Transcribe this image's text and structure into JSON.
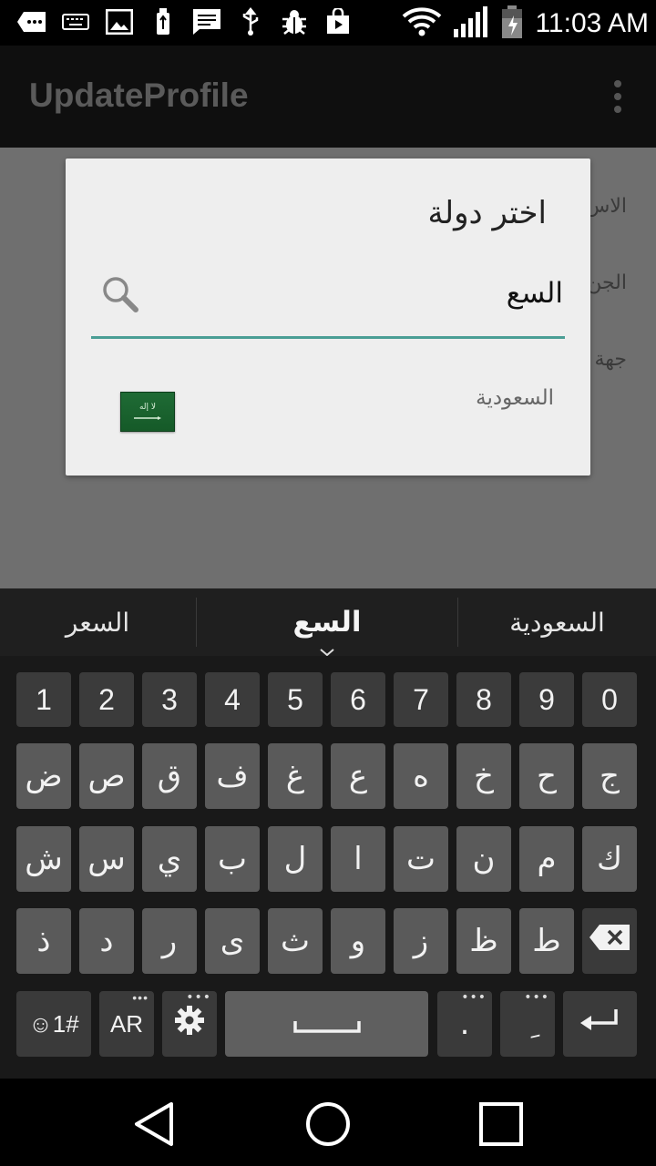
{
  "status_bar": {
    "time": "11:03 AM",
    "icons": [
      "chat-icon",
      "keyboard-icon",
      "image-icon",
      "usb-debug-icon",
      "message-icon",
      "usb-icon",
      "bug-icon",
      "store-icon",
      "wifi-icon",
      "signal-icon",
      "battery-icon"
    ]
  },
  "action_bar": {
    "title": "UpdateProfile",
    "overflow_icon": "overflow-menu-icon"
  },
  "background_labels": [
    "الاس",
    "الجن",
    "جهة"
  ],
  "dialog": {
    "title": "اختر دولة",
    "search_value": "السع",
    "search_icon": "search-icon",
    "results": [
      {
        "name": "السعودية",
        "flag": "saudi-flag-icon",
        "flag_color": "#1f6b35"
      }
    ]
  },
  "suggestions": {
    "left": "السعر",
    "middle": "السع",
    "right": "السعودية"
  },
  "keyboard": {
    "number_row": [
      "1",
      "2",
      "3",
      "4",
      "5",
      "6",
      "7",
      "8",
      "9",
      "0"
    ],
    "row1": [
      "ض",
      "ص",
      "ق",
      "ف",
      "غ",
      "ع",
      "ه",
      "خ",
      "ح",
      "ج"
    ],
    "row2": [
      "ش",
      "س",
      "ي",
      "ب",
      "ل",
      "ا",
      "ت",
      "ن",
      "م",
      "ك"
    ],
    "row3": [
      "ذ",
      "د",
      "ر",
      "ى",
      "ث",
      "و",
      "ز",
      "ظ",
      "ط"
    ],
    "bottom": {
      "symbols": "☺1#",
      "language": "AR",
      "settings_icon": "gear-icon",
      "space_icon": "space-bar-icon",
      "period": ".",
      "diacritic": "ِ",
      "enter_icon": "enter-icon",
      "backspace_icon": "backspace-icon"
    }
  },
  "nav_bar": {
    "back": "back-icon",
    "home": "home-icon",
    "recents": "recents-icon"
  },
  "colors": {
    "accent": "#4a9e95",
    "dim_overlay": "#6f6f6f",
    "key": "#5a5a5a",
    "key_dark": "#3a3a3a"
  }
}
